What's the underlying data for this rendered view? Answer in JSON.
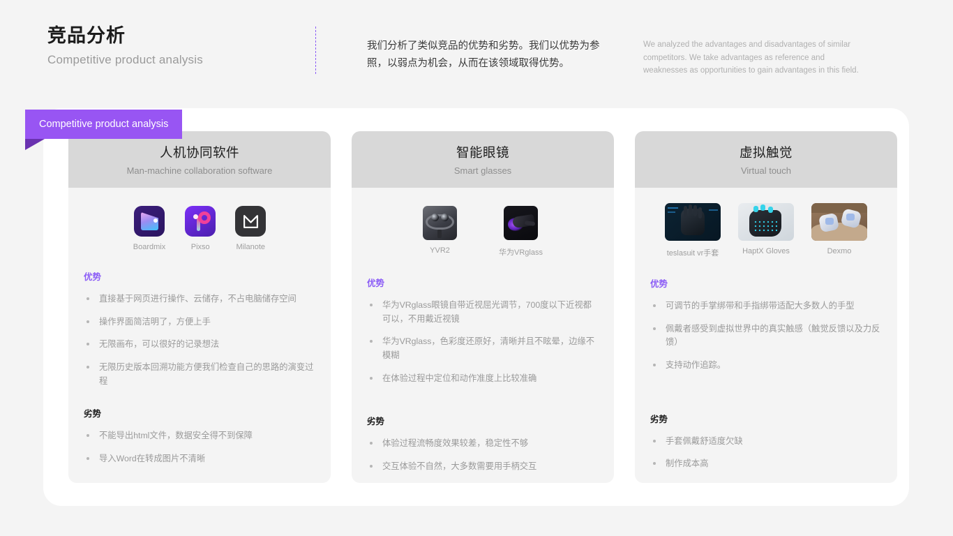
{
  "header": {
    "title_cn": "竞品分析",
    "title_en": "Competitive product analysis",
    "description_cn": "我们分析了类似竞品的优势和劣势。我们以优势为参照，以弱点为机会，从而在该领域取得优势。",
    "description_en": "We analyzed the advantages and disadvantages of similar competitors. We take advantages as reference and weaknesses as opportunities to gain advantages in this field."
  },
  "ribbon": {
    "label": "Competitive product analysis"
  },
  "colors": {
    "accent_purple": "#9855f3",
    "ribbon_fold": "#6a32b0",
    "advantage_heading": "#8b5cf6",
    "card_header_bg": "#d8d8d8",
    "card_bg": "#f4f4f4",
    "panel_bg": "#ffffff",
    "page_bg": "#f4f4f4"
  },
  "sections": {
    "advantages_label": "优势",
    "disadvantages_label": "劣势"
  },
  "cards": [
    {
      "title_cn": "人机协同软件",
      "title_en": "Man-machine collaboration software",
      "products": [
        {
          "label": "Boardmix",
          "icon": "boardmix-app-icon"
        },
        {
          "label": "Pixso",
          "icon": "pixso-app-icon"
        },
        {
          "label": "Milanote",
          "icon": "milanote-app-icon"
        }
      ],
      "advantages": [
        "直接基于网页进行操作、云储存，不占电脑储存空间",
        "操作界面简洁明了，方便上手",
        "无限画布，可以很好的记录想法",
        "无限历史版本回溯功能方便我们检查自己的思路的演变过程"
      ],
      "disadvantages": [
        "不能导出html文件，数据安全得不到保障",
        "导入Word在转成图片不清晰"
      ]
    },
    {
      "title_cn": "智能眼镜",
      "title_en": "Smart glasses",
      "products": [
        {
          "label": "YVR2",
          "icon": "yvr2-headset-photo"
        },
        {
          "label": "华为VRglass",
          "icon": "huawei-vrglass-photo"
        }
      ],
      "advantages": [
        "华为VRglass眼镜自带近视屈光调节，700度以下近视都可以，不用戴近视镜",
        "华为VRglass，色彩度还原好，清晰并且不眩晕，边缘不模糊",
        "在体验过程中定位和动作准度上比较准确"
      ],
      "disadvantages": [
        "体验过程流畅度效果较差，稳定性不够",
        "交互体验不自然，大多数需要用手柄交互"
      ]
    },
    {
      "title_cn": "虚拟触觉",
      "title_en": "Virtual touch",
      "products": [
        {
          "label": "teslasuit vr手套",
          "icon": "teslasuit-glove-photo"
        },
        {
          "label": "HaptX Gloves",
          "icon": "haptx-glove-photo"
        },
        {
          "label": "Dexmo",
          "icon": "dexmo-glove-photo"
        }
      ],
      "advantages": [
        "可调节的手掌绑带和手指绑带适配大多数人的手型",
        "佩戴者感受到虚拟世界中的真实触感（触觉反馈以及力反馈）",
        "支持动作追踪。"
      ],
      "disadvantages": [
        "手套佩戴舒适度欠缺",
        "制作成本高"
      ]
    }
  ]
}
